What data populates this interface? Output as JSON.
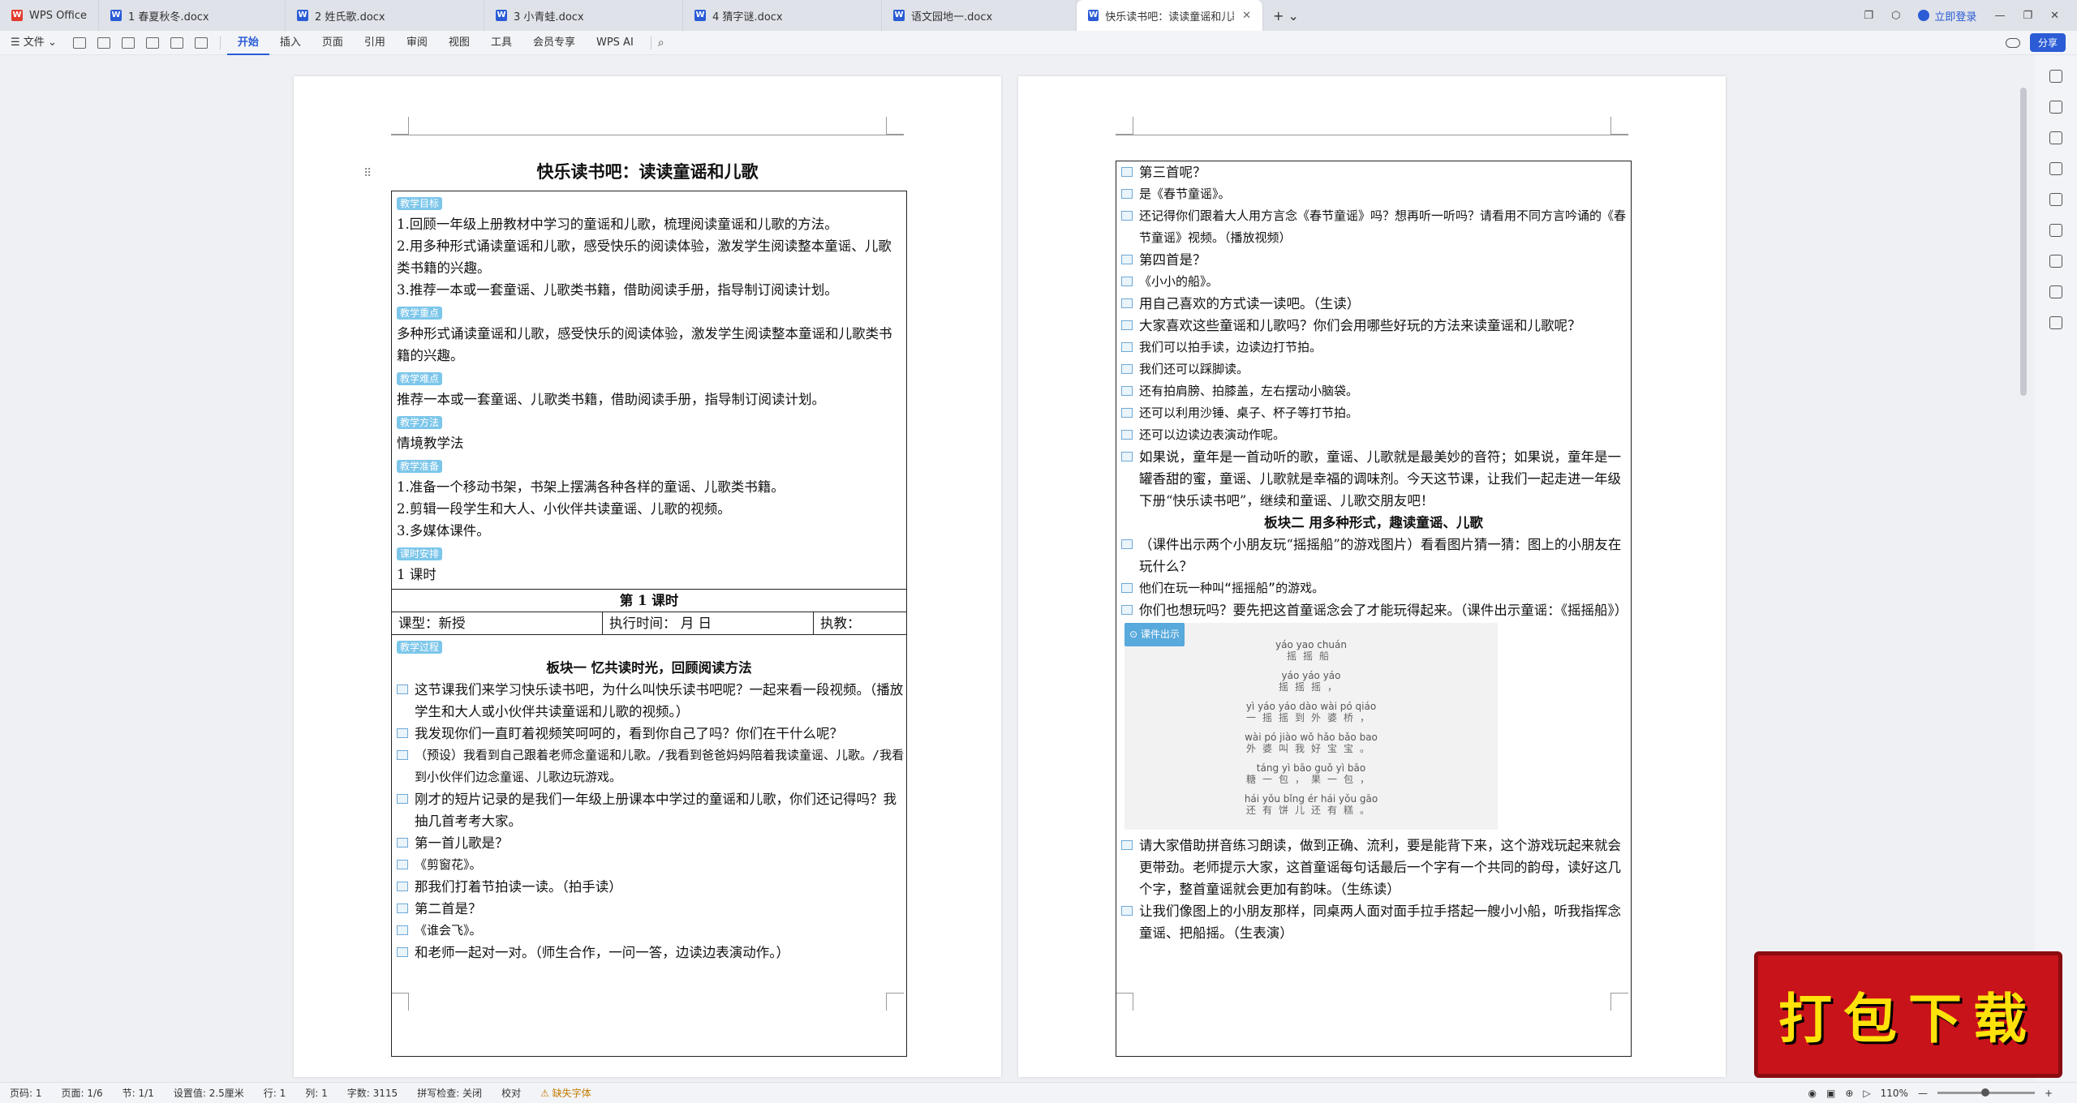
{
  "tabs": [
    {
      "label": "WPS Office",
      "type": "home"
    },
    {
      "label": "1 春夏秋冬.docx"
    },
    {
      "label": "2 姓氏歌.docx"
    },
    {
      "label": "3 小青蛙.docx"
    },
    {
      "label": "4 猜字谜.docx"
    },
    {
      "label": "语文园地一.docx"
    },
    {
      "label": "快乐读书吧：读读童谣和儿歌",
      "active": true
    }
  ],
  "login_label": "立即登录",
  "menu": {
    "file": "文件",
    "items": [
      "开始",
      "插入",
      "页面",
      "引用",
      "审阅",
      "视图",
      "工具",
      "会员专享",
      "WPS AI"
    ],
    "share": "分享"
  },
  "page1": {
    "title": "快乐读书吧：读读童谣和儿歌",
    "tags": {
      "goal": "教学目标",
      "key": "教学重点",
      "hard": "教学难点",
      "method": "教学方法",
      "prep": "教学准备",
      "time": "课时安排",
      "process": "教学过程"
    },
    "goals": [
      "1.回顾一年级上册教材中学习的童谣和儿歌，梳理阅读童谣和儿歌的方法。",
      "2.用多种形式诵读童谣和儿歌，感受快乐的阅读体验，激发学生阅读整本童谣、儿歌类书籍的兴趣。",
      "3.推荐一本或一套童谣、儿歌类书籍，借助阅读手册，指导制订阅读计划。"
    ],
    "key": "多种形式诵读童谣和儿歌，感受快乐的阅读体验，激发学生阅读整本童谣和儿歌类书籍的兴趣。",
    "hard": "推荐一本或一套童谣、儿歌类书籍，借助阅读手册，指导制订阅读计划。",
    "method": "情境教学法",
    "prep": [
      "1.准备一个移动书架，书架上摆满各种各样的童谣、儿歌类书籍。",
      "2.剪辑一段学生和大人、小伙伴共读童谣、儿歌的视频。",
      "3.多媒体课件。"
    ],
    "time": "1 课时",
    "lesson": "第 1 课时",
    "meta": {
      "type": "课型：新授",
      "exec": "执行时间：      月      日",
      "teacher": "执教："
    },
    "section1": "板块一 忆共读时光，回顾阅读方法",
    "lines": [
      {
        "t": "这节课我们来学习快乐读书吧，为什么叫快乐读书吧呢？一起来看一段视频。（播放学生和大人或小伙伴共读童谣和儿歌的视频。）"
      },
      {
        "t": "我发现你们一直盯着视频笑呵呵的，看到你自己了吗？你们在干什么呢？"
      },
      {
        "t": "（预设）我看到自己跟着老师念童谣和儿歌。/我看到爸爸妈妈陪着我读童谣、儿歌。/我看到小伙伴们边念童谣、儿歌边玩游戏。",
        "i": true
      },
      {
        "t": "刚才的短片记录的是我们一年级上册课本中学过的童谣和儿歌，你们还记得吗？我抽几首考考大家。"
      },
      {
        "t": "第一首儿歌是？"
      },
      {
        "t": "《剪窗花》。",
        "i": true
      },
      {
        "t": "那我们打着节拍读一读。（拍手读）"
      },
      {
        "t": "第二首是？"
      },
      {
        "t": "《谁会飞》。",
        "i": true
      },
      {
        "t": "和老师一起对一对。（师生合作，一问一答，边读边表演动作。）"
      }
    ]
  },
  "page2": {
    "lines_a": [
      {
        "t": "第三首呢？"
      },
      {
        "t": "是《春节童谣》。",
        "i": true
      },
      {
        "t": "还记得你们跟着大人用方言念《春节童谣》吗？想再听一听吗？请看用不同方言吟诵的《春节童谣》视频。（播放视频）",
        "i": true
      },
      {
        "t": "第四首是？"
      },
      {
        "t": "《小小的船》。",
        "i": true
      },
      {
        "t": "用自己喜欢的方式读一读吧。（生读）"
      },
      {
        "t": "大家喜欢这些童谣和儿歌吗？你们会用哪些好玩的方法来读童谣和儿歌呢？"
      },
      {
        "t": "我们可以拍手读，边读边打节拍。",
        "i": true
      },
      {
        "t": "我们还可以踩脚读。",
        "i": true
      },
      {
        "t": "还有拍肩膀、拍膝盖，左右摆动小脑袋。",
        "i": true
      },
      {
        "t": "还可以利用沙锤、桌子、杯子等打节拍。",
        "i": true
      },
      {
        "t": "还可以边读边表演动作呢。",
        "i": true
      },
      {
        "t": "如果说，童年是一首动听的歌，童谣、儿歌就是最美妙的音符；如果说，童年是一罐香甜的蜜，童谣、儿歌就是幸福的调味剂。今天这节课，让我们一起走进一年级下册“快乐读书吧”，继续和童谣、儿歌交朋友吧！"
      }
    ],
    "section2": "板块二 用多种形式，趣读童谣、儿歌",
    "lines_b": [
      {
        "t": "（课件出示两个小朋友玩“摇摇船”的游戏图片）看看图片猜一猜：图上的小朋友在玩什么？"
      },
      {
        "t": "他们在玩一种叫“摇摇船”的游戏。",
        "i": true
      },
      {
        "t": "你们也想玩吗？要先把这首童谣念会了才能玩得起来。（课件出示童谣：《摇摇船》）"
      }
    ],
    "img": {
      "tag": "课件出示",
      "poem": [
        {
          "py": "yáo yao chuán",
          "hz": "摇摇船"
        },
        {
          "py": "yáo yáo yáo",
          "hz": "摇摇摇，"
        },
        {
          "py": "yì yáo yáo dào wài pó qiáo",
          "hz": "一摇摇到外婆桥，"
        },
        {
          "py": "wài pó jiào wǒ hǎo bǎo bao",
          "hz": "外婆叫我好宝宝。"
        },
        {
          "py": "táng yì bāo  guǒ yì bāo",
          "hz": "糖一包，果一包，"
        },
        {
          "py": "hái yǒu bǐng ér hái yǒu gāo",
          "hz": "还有饼儿还有糕。"
        }
      ]
    },
    "lines_c": [
      {
        "t": "请大家借助拼音练习朗读，做到正确、流利，要是能背下来，这个游戏玩起来就会更带劲。老师提示大家，这首童谣每句话最后一个字有一个共同的韵母，读好这几个字，整首童谣就会更加有韵味。（生练读）"
      },
      {
        "t": "让我们像图上的小朋友那样，同桌两人面对面手拉手搭起一艘小小船，听我指挥念童谣、把船摇。（生表演）"
      }
    ]
  },
  "status": {
    "page": "页码: 1",
    "pages": "页面: 1/6",
    "section": "节: 1/1",
    "setting": "设置值: 2.5厘米",
    "row": "行: 1",
    "col": "列: 1",
    "words": "字数: 3115",
    "spell": "拼写检查: 关闭",
    "proof": "校对",
    "font": "缺失字体",
    "zoom": "110%"
  },
  "banner": "打包下载"
}
